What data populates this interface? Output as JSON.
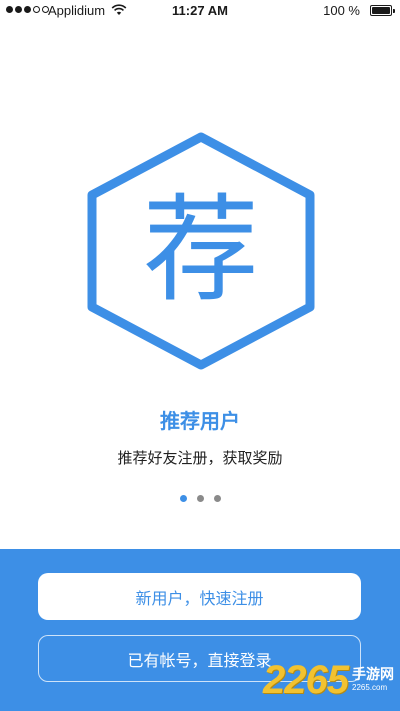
{
  "status_bar": {
    "carrier": "Applidium",
    "time": "11:27 AM",
    "battery": "100 %",
    "icons": [
      "signal-dots-icon",
      "wifi-icon",
      "battery-icon"
    ]
  },
  "hero": {
    "glyph": "荐",
    "title": "推荐用户",
    "subtitle": "推荐好友注册，获取奖励",
    "pager": {
      "total": 3,
      "active": 0
    }
  },
  "actions": {
    "register_label": "新用户，快速注册",
    "login_label": "已有帐号，直接登录"
  },
  "watermark": {
    "number": "2265",
    "text": "手游网",
    "url": "2265.com"
  },
  "colors": {
    "accent": "#3d8fe6",
    "background": "#ffffff",
    "watermark": "#f2c230"
  }
}
